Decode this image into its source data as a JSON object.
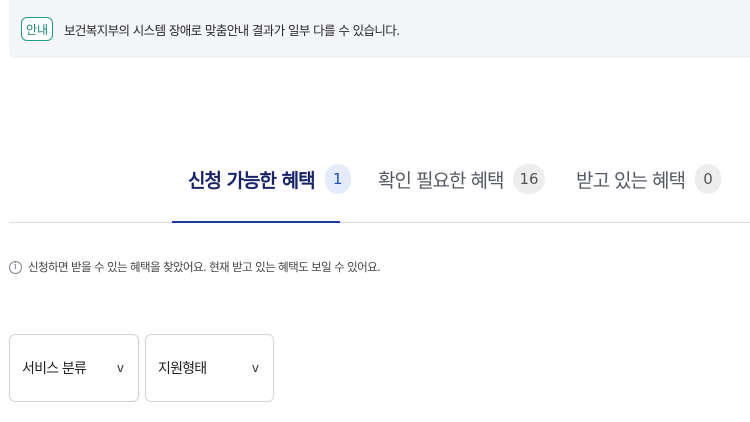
{
  "notice": {
    "badge": "안내",
    "text": "보건복지부의 시스템 장애로 맞춤안내 결과가 일부 다를 수 있습니다."
  },
  "tabs": [
    {
      "label": "신청 가능한 혜택",
      "count": "1",
      "active": true
    },
    {
      "label": "확인 필요한 혜택",
      "count": "16",
      "active": false
    },
    {
      "label": "받고 있는 혜택",
      "count": "0",
      "active": false
    }
  ],
  "info": {
    "icon": "info-icon",
    "text": "신청하면 받을 수 있는 혜택을 찾았어요. 현재 받고 있는 혜택도 보일 수 있어요."
  },
  "filters": [
    {
      "label": "서비스 분류",
      "chevron": "v"
    },
    {
      "label": "지원형태",
      "chevron": "v"
    }
  ],
  "colors": {
    "accent": "#1f3c9b",
    "badge_border": "#1d9e8e",
    "notice_bg": "#f3f5f8"
  }
}
